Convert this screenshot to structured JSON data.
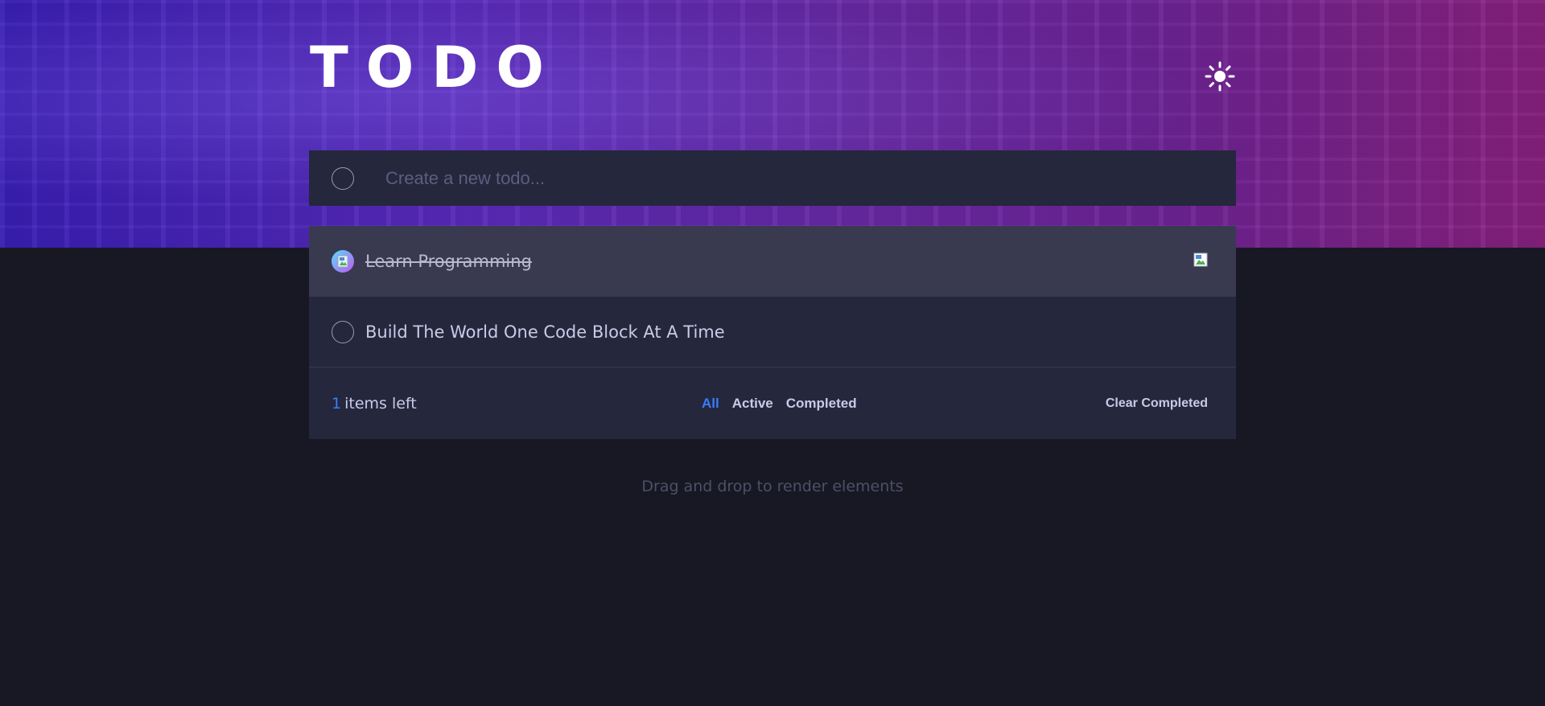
{
  "header": {
    "title": "TODO",
    "theme_icon": "sun-icon"
  },
  "new_todo": {
    "placeholder": "Create a new todo...",
    "value": ""
  },
  "todos": [
    {
      "text": "Learn Programming",
      "completed": true
    },
    {
      "text": "Build The World One Code Block At A Time",
      "completed": false
    }
  ],
  "footer": {
    "count": "1",
    "count_label": "items left",
    "filters": [
      "All",
      "Active",
      "Completed"
    ],
    "active_filter": "All",
    "clear_label": "Clear Completed"
  },
  "hint": "Drag and drop to render elements",
  "colors": {
    "accent": "#3a7cfd",
    "card": "#25273d",
    "background": "#171823"
  }
}
